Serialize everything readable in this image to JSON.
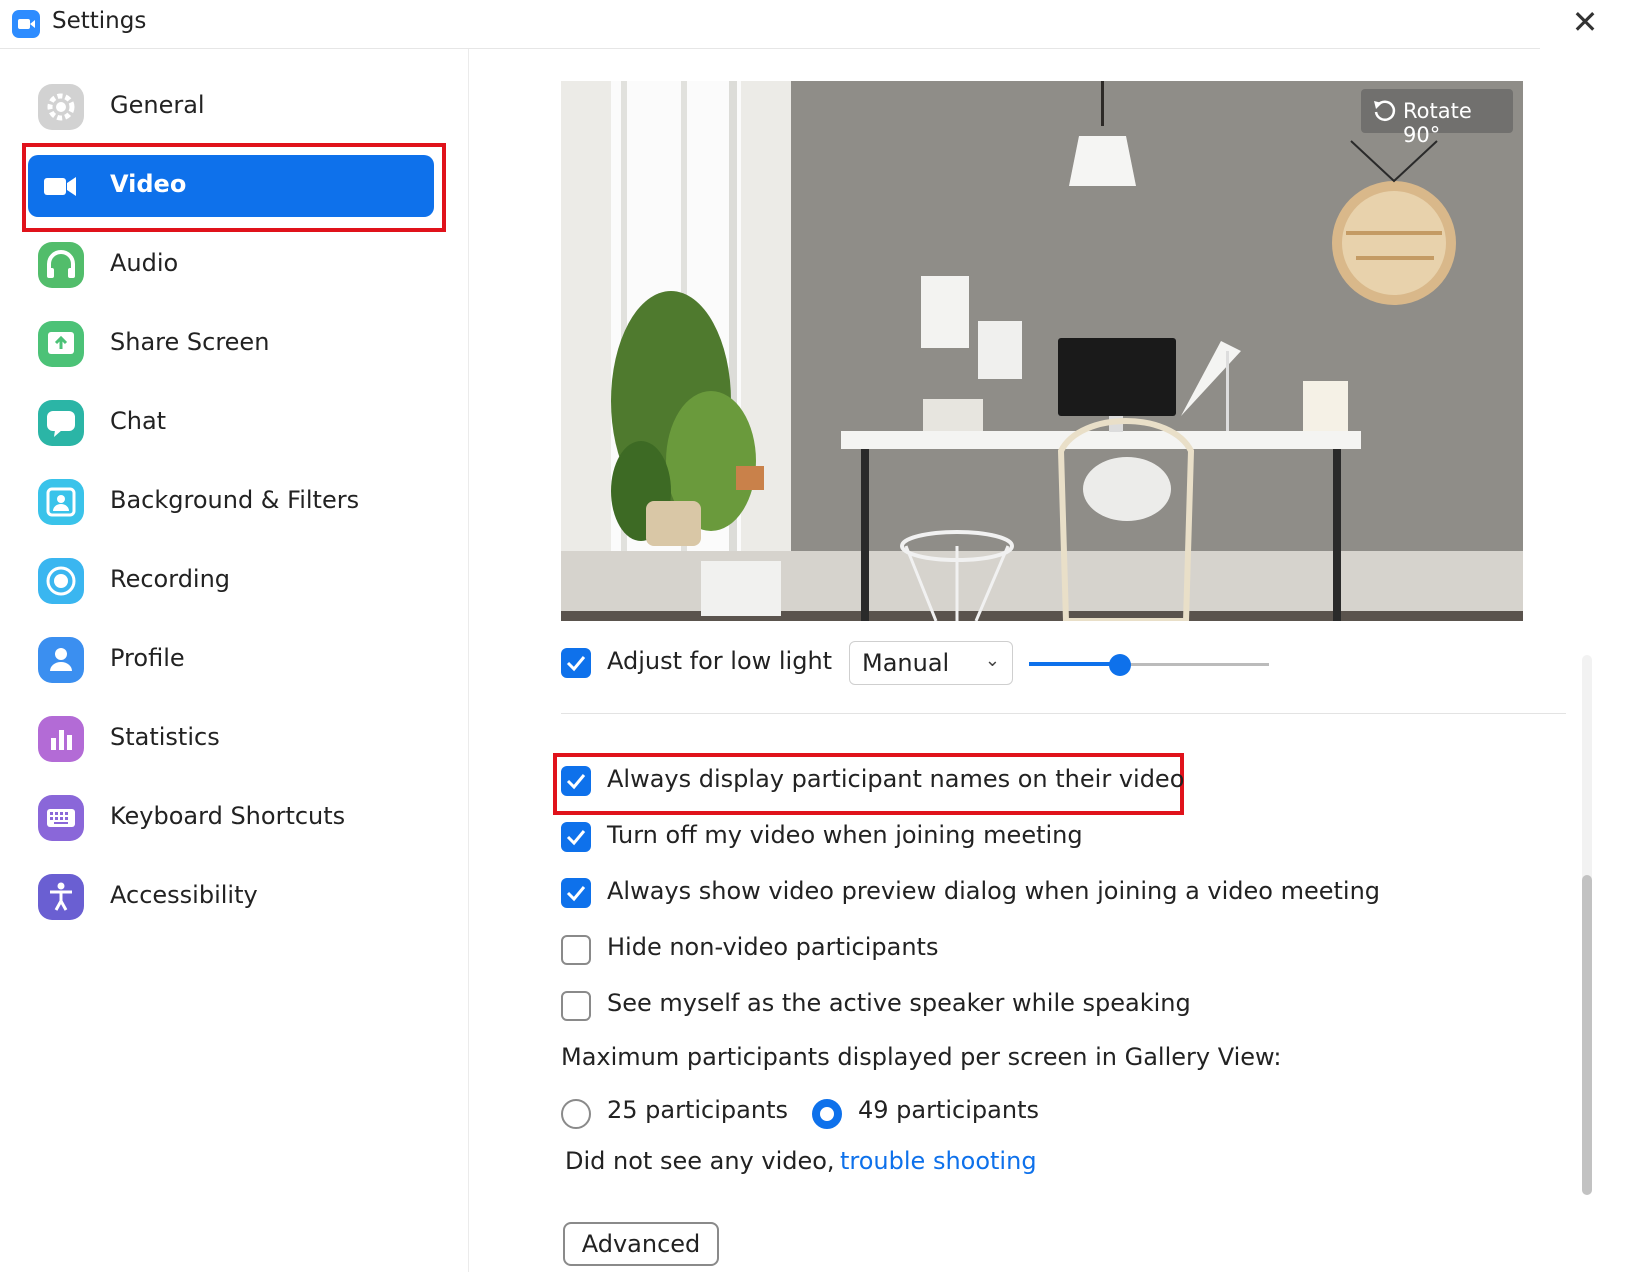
{
  "window": {
    "title": "Settings"
  },
  "sidebar": {
    "items": [
      {
        "label": "General",
        "icon": "gear-icon",
        "color": "#cfcfcf"
      },
      {
        "label": "Video",
        "icon": "video-camera-icon",
        "color": "#0e71eb",
        "active": true
      },
      {
        "label": "Audio",
        "icon": "headphones-icon",
        "color": "#52bd6b"
      },
      {
        "label": "Share Screen",
        "icon": "share-screen-icon",
        "color": "#4cc277"
      },
      {
        "label": "Chat",
        "icon": "chat-bubble-icon",
        "color": "#2bb5a6"
      },
      {
        "label": "Background & Filters",
        "icon": "person-portrait-icon",
        "color": "#3ac3ea"
      },
      {
        "label": "Recording",
        "icon": "record-icon",
        "color": "#3ab6f0"
      },
      {
        "label": "Profile",
        "icon": "profile-icon",
        "color": "#3b8ff0"
      },
      {
        "label": "Statistics",
        "icon": "bar-chart-icon",
        "color": "#b36bd6"
      },
      {
        "label": "Keyboard Shortcuts",
        "icon": "keyboard-icon",
        "color": "#8a67d9"
      },
      {
        "label": "Accessibility",
        "icon": "accessibility-icon",
        "color": "#6a5fd2"
      }
    ]
  },
  "preview": {
    "rotate_label": "Rotate 90°",
    "rotate_icon": "rotate-icon"
  },
  "low_light": {
    "label": "Adjust for low light",
    "checked": true,
    "mode": "Manual",
    "level_percent": 38
  },
  "options": [
    {
      "label": "Always display participant names on their video",
      "checked": true
    },
    {
      "label": "Turn off my video when joining meeting",
      "checked": true
    },
    {
      "label": "Always show video preview dialog when joining a video meeting",
      "checked": true
    },
    {
      "label": "Hide non-video participants",
      "checked": false
    },
    {
      "label": "See myself as the active speaker while speaking",
      "checked": false
    }
  ],
  "gallery": {
    "heading": "Maximum participants displayed per screen in Gallery View:",
    "choices": [
      {
        "label": "25 participants",
        "selected": false
      },
      {
        "label": "49 participants",
        "selected": true
      }
    ]
  },
  "troubleshoot": {
    "text": "Did not see any video,",
    "link": "trouble shooting"
  },
  "advanced_label": "Advanced",
  "colors": {
    "accent": "#0e71eb",
    "highlight": "#e0121b"
  }
}
